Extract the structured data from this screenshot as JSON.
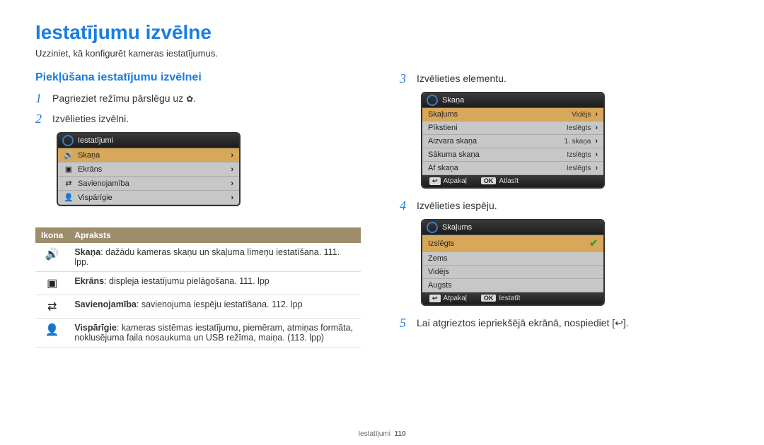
{
  "page": {
    "title": "Iestatījumu izvēlne",
    "intro": "Uzziniet, kā konfigurēt kameras iestatījumus.",
    "section": "Piekļūšana iestatījumu izvēlnei"
  },
  "steps": {
    "s1": "Pagrieziet režīmu pārslēgu uz ",
    "s1_suffix": ".",
    "s2": "Izvēlieties izvēlni.",
    "s3": "Izvēlieties elementu.",
    "s4": "Izvēlieties iespēju.",
    "s5_pre": "Lai atgrieztos iepriekšējā ekrānā, nospiediet [",
    "s5_post": "]."
  },
  "panel_menu": {
    "header": "Iestatījumi",
    "items": [
      {
        "icon": "🔊",
        "label": "Skaņa"
      },
      {
        "icon": "▣",
        "label": "Ekrāns"
      },
      {
        "icon": "⇄",
        "label": "Savienojamība"
      },
      {
        "icon": "👤",
        "label": "Vispārīgie"
      }
    ]
  },
  "panel_sound": {
    "header": "Skaņa",
    "rows": [
      {
        "label": "Skaļums",
        "value": "Vidējs",
        "sel": true
      },
      {
        "label": "Pīkstieni",
        "value": "Ieslēgts"
      },
      {
        "label": "Aizvara skaņa",
        "value": "1. skaņa"
      },
      {
        "label": "Sākuma skaņa",
        "value": "Izslēgts"
      },
      {
        "label": "Af skaņa",
        "value": "Ieslēgts"
      }
    ],
    "back": "Atpakaļ",
    "ok": "Atlasīt"
  },
  "panel_volume": {
    "header": "Skaļums",
    "rows": [
      {
        "label": "Izslēgts",
        "check": true
      },
      {
        "label": "Zems"
      },
      {
        "label": "Vidējs"
      },
      {
        "label": "Augsts"
      }
    ],
    "back": "Atpakaļ",
    "ok": "Iestatīt"
  },
  "table": {
    "h_icon": "Ikona",
    "h_desc": "Apraksts",
    "rows": [
      {
        "icon": "🔊",
        "name": "Skaņa",
        "text": ": dažādu kameras skaņu un skaļuma līmeņu iestatīšana. 111. lpp."
      },
      {
        "icon": "▣",
        "name": "Ekrāns",
        "text": ": displeja iestatījumu pielāgošana. 111. lpp"
      },
      {
        "icon": "⇄",
        "name": "Savienojamība",
        "text": ": savienojuma iespēju iestatīšana. 112. lpp"
      },
      {
        "icon": "👤",
        "name": "Vispārīgie",
        "text": ": kameras sistēmas iestatījumu, piemēram, atmiņas formāta, noklusējuma faila nosaukuma un USB režīma, maiņa. (113. lpp)"
      }
    ]
  },
  "footer": {
    "label": "Iestatījumi",
    "page": "110"
  },
  "keys": {
    "back": "↩",
    "ok": "OK"
  }
}
